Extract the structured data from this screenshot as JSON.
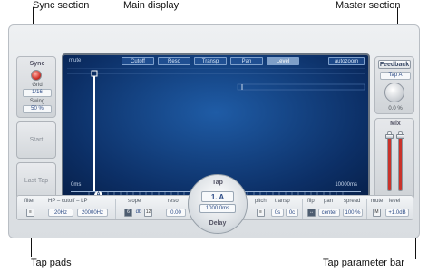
{
  "callouts": {
    "sync_section": "Sync section",
    "main_display": "Main display",
    "master_section": "Master section",
    "tap_pads": "Tap pads",
    "tap_parameter_bar": "Tap parameter bar"
  },
  "sync": {
    "title": "Sync",
    "grid_label": "Grid",
    "grid_value": "1/16",
    "swing_label": "Swing",
    "swing_value": "50 %"
  },
  "pads": {
    "start_label": "Start",
    "last_tap_label": "Last Tap"
  },
  "display": {
    "mute_label": "mute",
    "modes": [
      "Cutoff",
      "Reso",
      "Transp",
      "Pan",
      "Level"
    ],
    "active_mode": "Level",
    "autozoom_label": "autozoom",
    "time_start": "0ms",
    "time_end": "10000ms",
    "tap_marker": "A"
  },
  "master": {
    "feedback_label": "Feedback",
    "feedback_source": "Tap A",
    "feedback_value": "0.0 %",
    "mix_label": "Mix"
  },
  "tap_delay": {
    "tap_label": "Tap",
    "selected_tap": "1. A",
    "tap_time": "1000.0ms",
    "delay_label": "Delay"
  },
  "param_bar": {
    "filter_label": "filter",
    "hp_lp_label": "HP – cutoff – LP",
    "filter_toggle": "≡",
    "hp_value": "20Hz",
    "lp_value": "20000Hz",
    "slope_label": "slope",
    "slope_6": "6",
    "slope_db": "db",
    "slope_12": "12",
    "reso_label": "reso",
    "reso_value": "0.00",
    "pitch_label": "pitch",
    "transp_label": "transp",
    "pitch_toggle": "≡",
    "transp_semi": "0s",
    "transp_cent": "0c",
    "flip_label": "flip",
    "pan_label": "pan",
    "spread_label": "spread",
    "flip_btn": "↔",
    "pan_value": "center",
    "spread_value": "100 %",
    "mute_label": "mute",
    "level_label": "level",
    "mute_btn": "M",
    "level_value": "+1.0dB"
  },
  "colors": {
    "display_bg": "#0c2f66",
    "accent_red": "#c9322a",
    "value_text": "#2c4b86"
  }
}
